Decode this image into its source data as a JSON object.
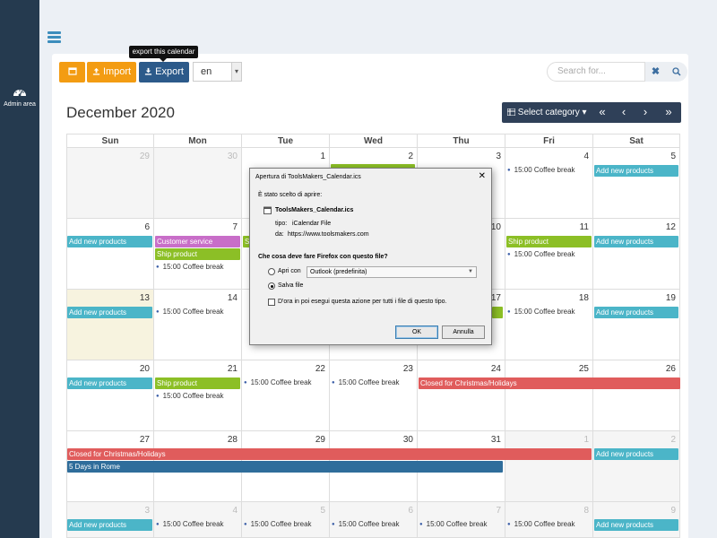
{
  "sidebar": {
    "admin_label": "Admin area",
    "admin_icon": "dashboard-icon"
  },
  "toolbar": {
    "import_label": "Import",
    "export_label": "Export",
    "export_tooltip": "export this calendar",
    "language_value": "en",
    "search_placeholder": "Search for...",
    "clear_symbol": "✖"
  },
  "calendar": {
    "title": "December 2020",
    "select_category_label": "Select category",
    "nav": [
      "«",
      "‹",
      "›",
      "»"
    ],
    "days_of_week": [
      "Sun",
      "Mon",
      "Tue",
      "Wed",
      "Thu",
      "Fri",
      "Sat"
    ],
    "weeks": [
      [
        "29",
        "30",
        "1",
        "2",
        "3",
        "4",
        "5"
      ],
      [
        "6",
        "7",
        "8",
        "9",
        "10",
        "11",
        "12"
      ],
      [
        "13",
        "14",
        "15",
        "16",
        "17",
        "18",
        "19"
      ],
      [
        "20",
        "21",
        "22",
        "23",
        "24",
        "25",
        "26"
      ],
      [
        "27",
        "28",
        "29",
        "30",
        "31",
        "1",
        "2"
      ],
      [
        "3",
        "4",
        "5",
        "6",
        "7",
        "8",
        "9"
      ]
    ],
    "events": {
      "add_new_products": "Add new products",
      "customer_service": "Customer service",
      "ship_product": "Ship product",
      "coffee_break": "15:00 Coffee break",
      "closed_holidays": "Closed for Christmas/Holidays",
      "rome_trip": "5 Days in Rome",
      "partial_s": "S"
    },
    "colors": {
      "teal": "#4bb5c8",
      "purple": "#c86ec8",
      "green": "#8cbf26",
      "red": "#e05c5c",
      "blue": "#2f6d9b"
    }
  },
  "dialog": {
    "title": "Apertura di ToolsMakers_Calendar.ics",
    "close": "✕",
    "intro": "È stato scelto di aprire:",
    "file_name": "ToolsMakers_Calendar.ics",
    "type_label": "tipo:",
    "type_value": "iCalendar File",
    "from_label": "da:",
    "from_value": "https://www.toolsmakers.com",
    "question": "Che cosa deve fare Firefox con questo file?",
    "open_with_label": "Apri con",
    "open_with_value": "Outlook (predefinita)",
    "save_label": "Salva file",
    "remember_label": "D'ora in poi esegui questa azione per tutti i file di questo tipo.",
    "ok_label": "OK",
    "cancel_label": "Annulla"
  }
}
